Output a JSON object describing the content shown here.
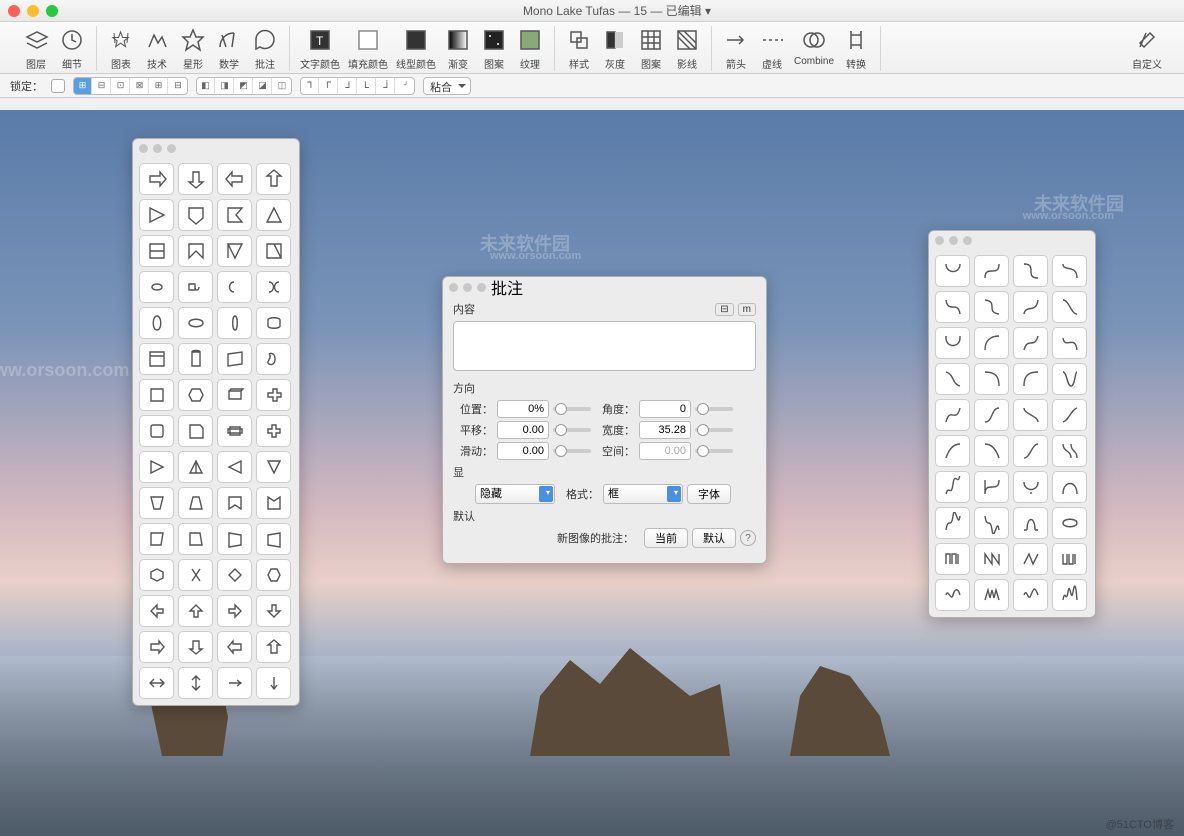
{
  "window": {
    "title": "Mono Lake Tufas — 15 — 已编辑 ▾"
  },
  "toolbar": {
    "g1": [
      {
        "n": "layers-icon",
        "l": "图层"
      },
      {
        "n": "detail-icon",
        "l": "细节"
      }
    ],
    "g2": [
      {
        "n": "chart-icon",
        "l": "图表"
      },
      {
        "n": "tech-icon",
        "l": "技术"
      },
      {
        "n": "star-icon",
        "l": "星形"
      },
      {
        "n": "math-icon",
        "l": "数学"
      },
      {
        "n": "annotate-icon",
        "l": "批注"
      }
    ],
    "g3": [
      {
        "n": "text-color-icon",
        "l": "文字颜色"
      },
      {
        "n": "fill-color-icon",
        "l": "填充颜色"
      },
      {
        "n": "line-color-icon",
        "l": "线型颜色"
      },
      {
        "n": "gradient-icon",
        "l": "渐变"
      },
      {
        "n": "pattern-icon",
        "l": "图案"
      },
      {
        "n": "texture-icon",
        "l": "纹理"
      }
    ],
    "g4": [
      {
        "n": "style-icon",
        "l": "样式"
      },
      {
        "n": "gray-icon",
        "l": "灰度"
      },
      {
        "n": "pattern2-icon",
        "l": "图案"
      },
      {
        "n": "shadow-icon",
        "l": "影线"
      }
    ],
    "g5": [
      {
        "n": "arrow-icon",
        "l": "箭头"
      },
      {
        "n": "dash-icon",
        "l": "虚线"
      },
      {
        "n": "combine-icon",
        "l": "Combine"
      },
      {
        "n": "transform-icon",
        "l": "转换"
      }
    ],
    "g6": [
      {
        "n": "custom-icon",
        "l": "自定义"
      }
    ]
  },
  "optbar": {
    "lock_label": "锁定：",
    "snap_label": "粘合"
  },
  "annotate": {
    "panel_title": "批注",
    "content_label": "内容",
    "content_value": "",
    "unit_btn": "m",
    "direction_label": "方向",
    "position_label": "位置：",
    "position_value": "0%",
    "angle_label": "角度：",
    "angle_value": "0",
    "shift_label": "平移：",
    "shift_value": "0.00",
    "width_label": "宽度：",
    "width_value": "35.28",
    "slide_label": "滑动：",
    "slide_value": "0.00",
    "space_label": "空间：",
    "space_value": "0.00",
    "display_label": "显",
    "hide_select": "隐藏",
    "format_label": "格式：",
    "format_select": "框",
    "font_btn": "字体",
    "default_label": "默认",
    "newimg_label": "新图像的批注：",
    "current_btn": "当前",
    "default_btn": "默认"
  },
  "watermarks": {
    "w1": "未来软件园",
    "w2": "www.orsoon.com"
  },
  "footer": "@51CTO博客"
}
